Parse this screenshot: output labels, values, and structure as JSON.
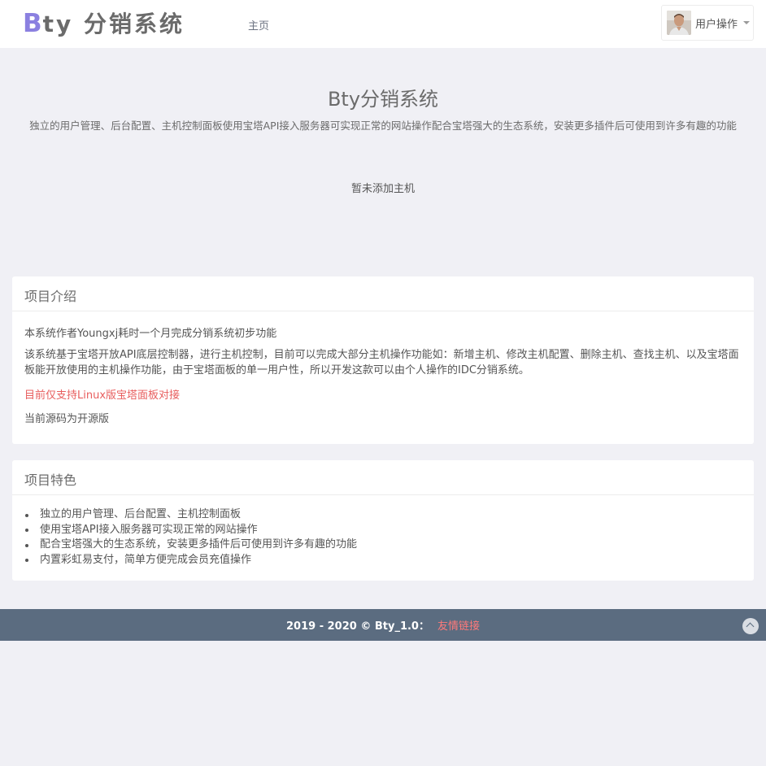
{
  "header": {
    "logo_initial": "B",
    "logo_rest": "ty 分销系统",
    "nav_home": "主页",
    "user_menu_label": "用户操作"
  },
  "hero": {
    "title": "Bty分销系统",
    "description": "独立的用户管理、后台配置、主机控制面板使用宝塔API接入服务器可实现正常的网站操作配合宝塔强大的生态系统，安装更多插件后可使用到许多有趣的功能",
    "empty_hosts": "暂未添加主机"
  },
  "intro": {
    "title": "项目介绍",
    "p1": "本系统作者Youngxj耗时一个月完成分销系统初步功能",
    "p2": "该系统基于宝塔开放API底层控制器，进行主机控制，目前可以完成大部分主机操作功能如：新增主机、修改主机配置、删除主机、查找主机、以及宝塔面板能开放使用的主机操作功能，由于宝塔面板的单一用户性，所以开发这款可以由个人操作的IDC分销系统。",
    "p3_notice": "目前仅支持Linux版宝塔面板对接",
    "p4": "当前源码为开源版"
  },
  "features": {
    "title": "项目特色",
    "items": [
      "独立的用户管理、后台配置、主机控制面板",
      "使用宝塔API接入服务器可实现正常的网站操作",
      "配合宝塔强大的生态系统，安装更多插件后可使用到许多有趣的功能",
      "内置彩虹易支付，简单方便完成会员充值操作"
    ]
  },
  "footer": {
    "copyright": "2019 - 2020 © Bty_1.0：",
    "link": "友情链接"
  },
  "colors": {
    "accent": "#8b80e0",
    "footer_bg": "#5b6c80",
    "notice": "#e85e5e",
    "page_bg": "#f0f0f5"
  },
  "icons": {
    "user_avatar": "avatar-photo",
    "dropdown": "caret-down-icon",
    "back_to_top": "chevron-up-icon"
  }
}
